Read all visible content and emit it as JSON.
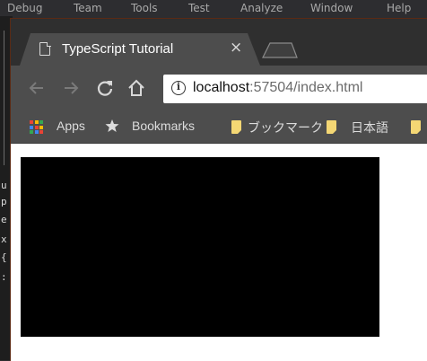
{
  "ide": {
    "menu_items": [
      "Debug",
      "Team",
      "Tools",
      "Test",
      "Analyze",
      "Window",
      "Help"
    ],
    "gutter_chars": [
      "u",
      "p",
      "e",
      "x",
      "{",
      ":"
    ]
  },
  "browser": {
    "tab": {
      "title": "TypeScript Tutorial",
      "close_label": "×",
      "icon": "document-icon"
    },
    "address": {
      "host": "localhost",
      "path": ":57504/index.html"
    },
    "bookmarks": [
      {
        "label": "Apps",
        "icon": "apps-grid-icon"
      },
      {
        "label": "Bookmarks",
        "icon": "star-icon"
      },
      {
        "label": "ブックマーク",
        "icon": "folder-icon"
      },
      {
        "label": "日本語",
        "icon": "folder-icon"
      }
    ]
  },
  "page": {
    "canvas_color": "#000000"
  },
  "colors": {
    "chrome_dark": "#2f2f2f",
    "chrome_toolbar": "#4d4d4d",
    "ide_background": "#2d2d30"
  }
}
